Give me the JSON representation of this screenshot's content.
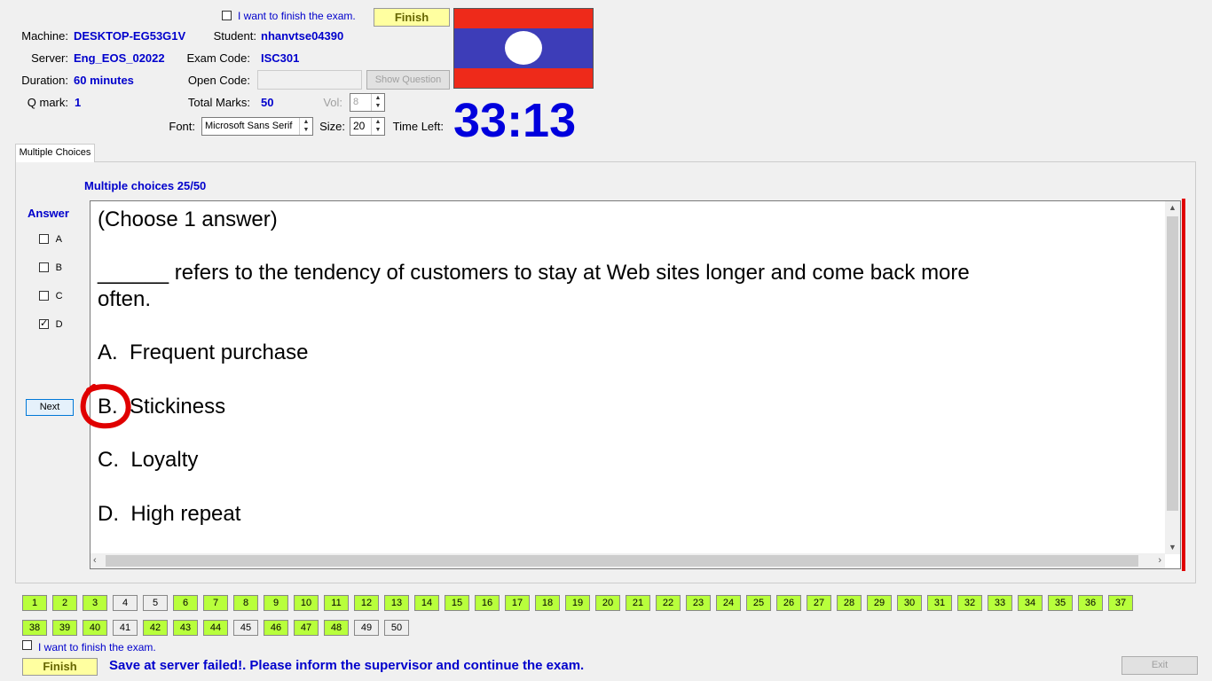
{
  "header": {
    "finish_checkbox_label": "I want to finish the exam.",
    "finish_button": "Finish",
    "machine_label": "Machine:",
    "machine_value": "DESKTOP-EG53G1V",
    "student_label": "Student:",
    "student_value": "nhanvtse04390",
    "server_label": "Server:",
    "server_value": "Eng_EOS_02022",
    "exam_code_label": "Exam Code:",
    "exam_code_value": "ISC301",
    "duration_label": "Duration:",
    "duration_value": "60 minutes",
    "open_code_label": "Open Code:",
    "open_code_value": "",
    "show_question_button": "Show Question",
    "qmark_label": "Q mark:",
    "qmark_value": "1",
    "total_marks_label": "Total Marks:",
    "total_marks_value": "50",
    "vol_label": "Vol:",
    "vol_value": "8",
    "font_label": "Font:",
    "font_value": "Microsoft Sans Serif",
    "size_label": "Size:",
    "size_value": "20",
    "time_left_label": "Time Left:",
    "time_left_value": "33:13"
  },
  "flag": {
    "top": "#ee2a1a",
    "middle": "#3d3db8",
    "bottom": "#ee2a1a",
    "circle": "#ffffff"
  },
  "tab": {
    "label": "Multiple Choices"
  },
  "question": {
    "progress": "Multiple choices 25/50",
    "answer_heading": "Answer",
    "options": [
      {
        "key": "A",
        "checked": false
      },
      {
        "key": "B",
        "checked": false
      },
      {
        "key": "C",
        "checked": false
      },
      {
        "key": "D",
        "checked": true
      }
    ],
    "next_button": "Next",
    "instruction": "(Choose 1 answer)",
    "stem_line1": "______ refers to the tendency of customers to stay at Web sites longer and come back more",
    "stem_line2": "often.",
    "choices": [
      {
        "letter": "A.",
        "text": "Frequent purchase"
      },
      {
        "letter": "B.",
        "text": "Stickiness"
      },
      {
        "letter": "C.",
        "text": "Loyalty"
      },
      {
        "letter": "D.",
        "text": "High repeat"
      }
    ]
  },
  "question_grid": {
    "row1": [
      "1",
      "2",
      "3",
      "4",
      "5",
      "6",
      "7",
      "8",
      "9",
      "10",
      "11",
      "12",
      "13",
      "14",
      "15",
      "16",
      "17",
      "18",
      "19",
      "20",
      "21",
      "22",
      "23",
      "24",
      "25",
      "26",
      "27",
      "28",
      "29",
      "30",
      "31",
      "32",
      "33",
      "34",
      "35",
      "36",
      "37"
    ],
    "row2": [
      "38",
      "39",
      "40",
      "41",
      "42",
      "43",
      "44",
      "45",
      "46",
      "47",
      "48",
      "49",
      "50"
    ],
    "unanswered": [
      "4",
      "5",
      "41",
      "45",
      "49",
      "50"
    ]
  },
  "footer": {
    "finish_checkbox_label": "I want to finish the exam.",
    "finish_button": "Finish",
    "status_message": "Save at server failed!. Please inform the supervisor and continue the exam.",
    "exit_button": "Exit"
  },
  "colors": {
    "accent_blue": "#0000cc",
    "answered_green": "#b8ff3c",
    "scroll_red": "#e00000",
    "annotation_red": "#e00000"
  }
}
